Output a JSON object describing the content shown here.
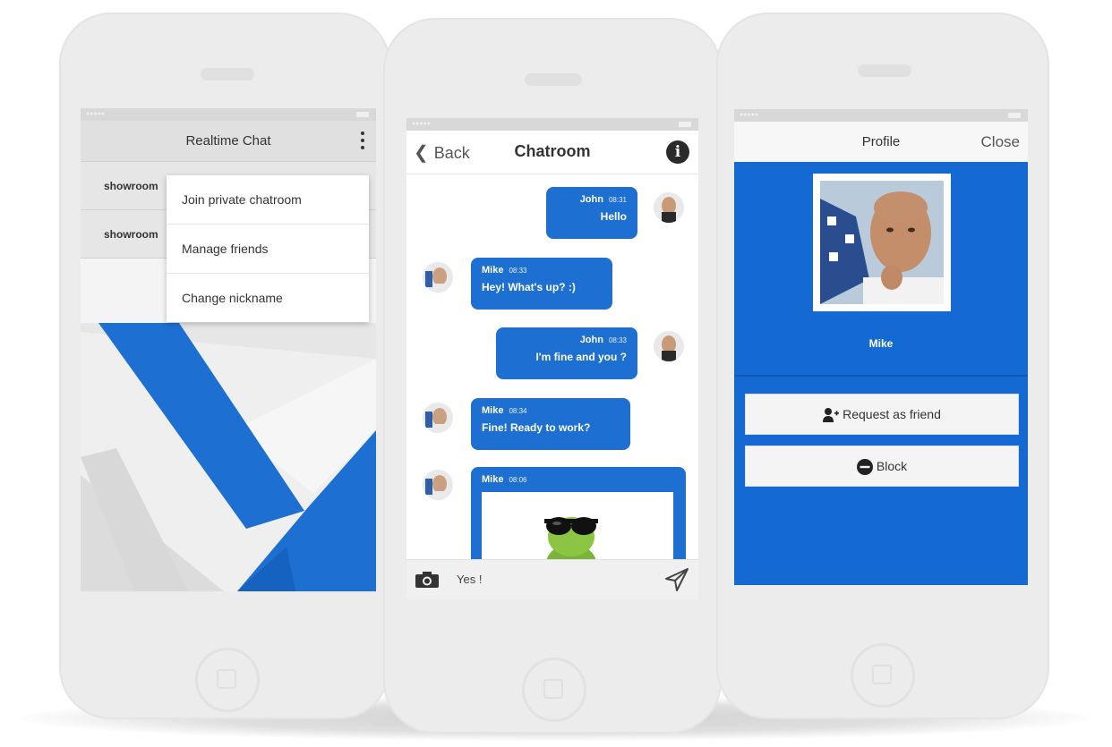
{
  "colors": {
    "accent": "#1d6fd1",
    "profile_bg": "#1569d3"
  },
  "phone1": {
    "header": {
      "title": "Realtime Chat"
    },
    "list": [
      {
        "label": "showroom"
      },
      {
        "label": "showroom"
      }
    ],
    "menu": [
      {
        "label": "Join private chatroom"
      },
      {
        "label": "Manage friends"
      },
      {
        "label": "Change nickname"
      }
    ]
  },
  "phone2": {
    "header": {
      "back_label": "Back",
      "title": "Chatroom",
      "info_icon": "info-icon"
    },
    "messages": [
      {
        "sender": "John",
        "time": "08:31",
        "text": "Hello",
        "mine": true
      },
      {
        "sender": "Mike",
        "time": "08:33",
        "text": "Hey! What's up? :)",
        "mine": false
      },
      {
        "sender": "John",
        "time": "08:33",
        "text": "I'm fine and you ?",
        "mine": true
      },
      {
        "sender": "Mike",
        "time": "08:34",
        "text": "Fine! Ready to work?",
        "mine": false
      },
      {
        "sender": "Mike",
        "time": "08:06",
        "text": "",
        "mine": false,
        "image": "frog-with-sunglasses"
      }
    ],
    "composer": {
      "value": "Yes !",
      "camera_icon": "camera-icon",
      "send_icon": "send-icon"
    }
  },
  "phone3": {
    "header": {
      "title": "Profile",
      "close_label": "Close"
    },
    "name": "Mike",
    "buttons": [
      {
        "label": "Request as friend",
        "icon": "add-user-icon"
      },
      {
        "label": "Block",
        "icon": "block-icon"
      }
    ]
  }
}
